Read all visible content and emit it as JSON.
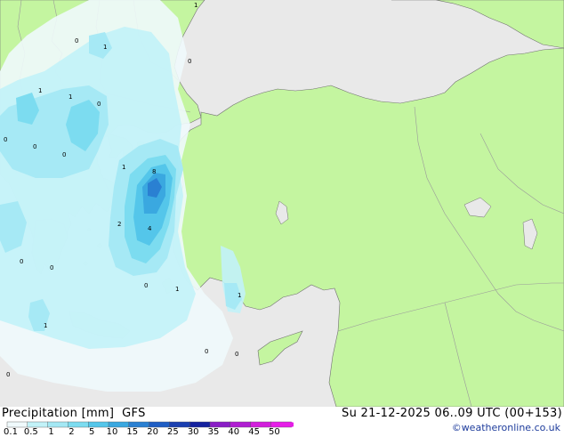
{
  "footer": {
    "parameter_label": "Precipitation [mm]",
    "model_label": "GFS",
    "datetime_label": "Su 21-12-2025 06..09 UTC (00+153)",
    "credit": "©weatheronline.co.uk"
  },
  "colorbar": {
    "ticks": [
      "0.1",
      "0.5",
      "1",
      "2",
      "5",
      "10",
      "15",
      "20",
      "25",
      "30",
      "35",
      "40",
      "45",
      "50"
    ],
    "colors": [
      "#f0fafc",
      "#c2f2f8",
      "#a4e8f4",
      "#7cdcf0",
      "#54c6ea",
      "#3aa8e0",
      "#2a80d2",
      "#1f5ec4",
      "#1a3fb0",
      "#14229e",
      "#8a1ec6",
      "#b01ed2",
      "#d21edc",
      "#e61ee8"
    ]
  },
  "colors": {
    "land": "#c4f5a0",
    "sea": "#e9e9e9",
    "border": "#9a9a9a",
    "coast": "#707070"
  },
  "map_labels": [
    {
      "text": "1"
    },
    {
      "text": "0"
    },
    {
      "text": "1"
    },
    {
      "text": "0"
    },
    {
      "text": "1"
    },
    {
      "text": "1"
    },
    {
      "text": "0"
    },
    {
      "text": "0"
    },
    {
      "text": "0"
    },
    {
      "text": "0"
    },
    {
      "text": "1"
    },
    {
      "text": "8"
    },
    {
      "text": "2"
    },
    {
      "text": "4"
    },
    {
      "text": "0"
    },
    {
      "text": "0"
    },
    {
      "text": "0"
    },
    {
      "text": "1"
    },
    {
      "text": "1"
    },
    {
      "text": "1"
    },
    {
      "text": "0"
    },
    {
      "text": "0"
    },
    {
      "text": "0"
    }
  ]
}
